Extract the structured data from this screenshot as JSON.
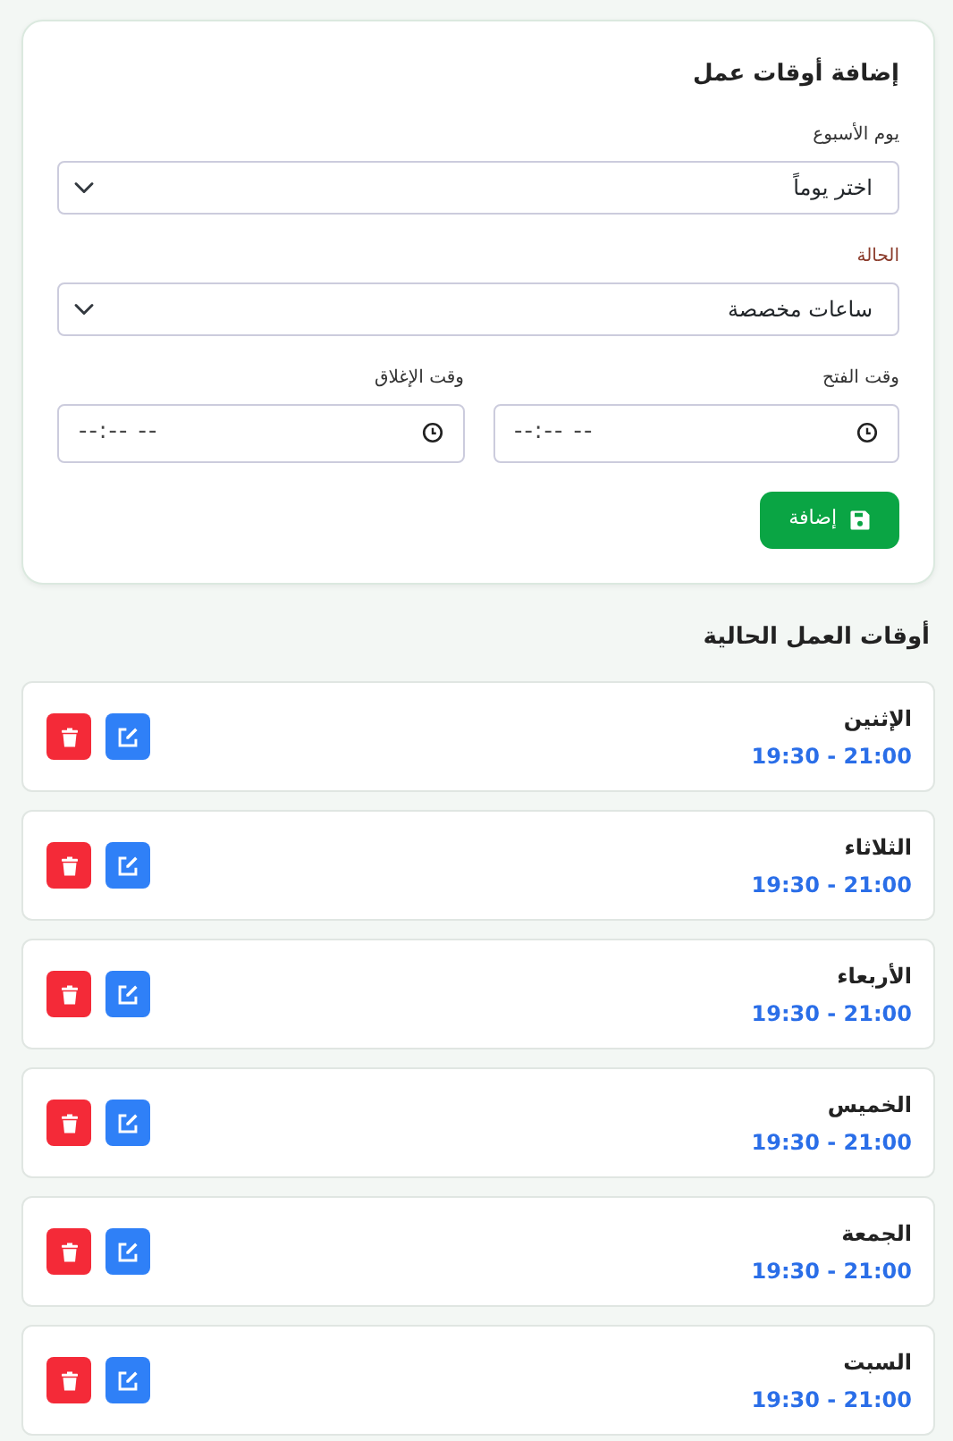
{
  "form": {
    "title": "إضافة أوقات عمل",
    "day": {
      "label": "يوم الأسبوع",
      "value": "اختر يوماً"
    },
    "status": {
      "label": "الحالة",
      "value": "ساعات مخصصة"
    },
    "times": [
      {
        "label": "وقت الفتح",
        "value": "--:-- --"
      },
      {
        "label": "وقت الإغلاق",
        "value": "--:-- --"
      }
    ],
    "submit": "إضافة"
  },
  "list": {
    "title": "أوقات العمل الحالية",
    "items": [
      {
        "day": "الإثنين",
        "hours": "19:30 - 21:00"
      },
      {
        "day": "الثلاثاء",
        "hours": "19:30 - 21:00"
      },
      {
        "day": "الأربعاء",
        "hours": "19:30 - 21:00"
      },
      {
        "day": "الخميس",
        "hours": "19:30 - 21:00"
      },
      {
        "day": "الجمعة",
        "hours": "19:30 - 21:00"
      },
      {
        "day": "السبت",
        "hours": "19:30 - 21:00"
      }
    ]
  }
}
